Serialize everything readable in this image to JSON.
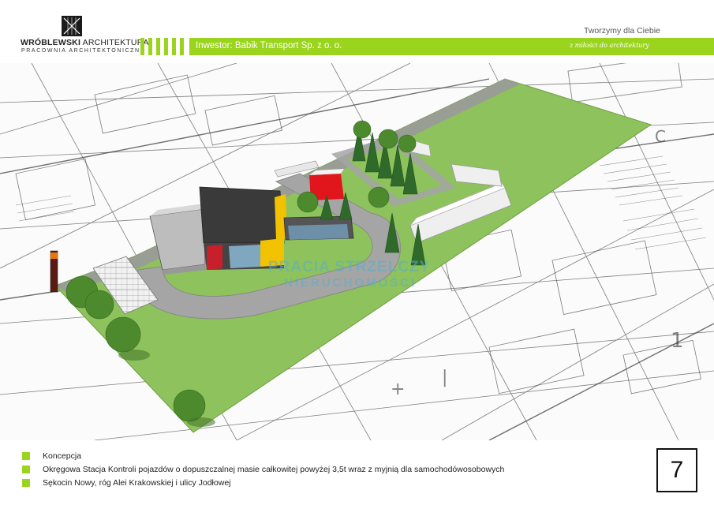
{
  "header": {
    "logo_name_bold": "WRÓBLEWSKI",
    "logo_name_light": " ARCHITEKTURA",
    "logo_sub": "PRACOWNIA ARCHITEKTONICZNA",
    "investor": "Inwestor: Babik Transport Sp. z o. o.",
    "motto": "Tworzymy dla Ciebie",
    "signature": "z miłości do architektury",
    "accent_color": "#9bd41c"
  },
  "render": {
    "watermark_line1": "PRACIA STRZELCZY",
    "watermark_line2": "NIERUCHOMOŚCI",
    "icons": [
      "architect-logo-icon",
      "site-plan-render"
    ]
  },
  "footer": {
    "items": [
      "Koncepcja",
      "Okręgowa Stacja Kontroli pojazdów o dopuszczalnej masie całkowitej powyżej 3,5t wraz z myjnią dla samochodówosobowych",
      "Sękocin Nowy, róg Alei Krakowskiej i ulicy Jodłowej"
    ],
    "page_number": "7"
  }
}
